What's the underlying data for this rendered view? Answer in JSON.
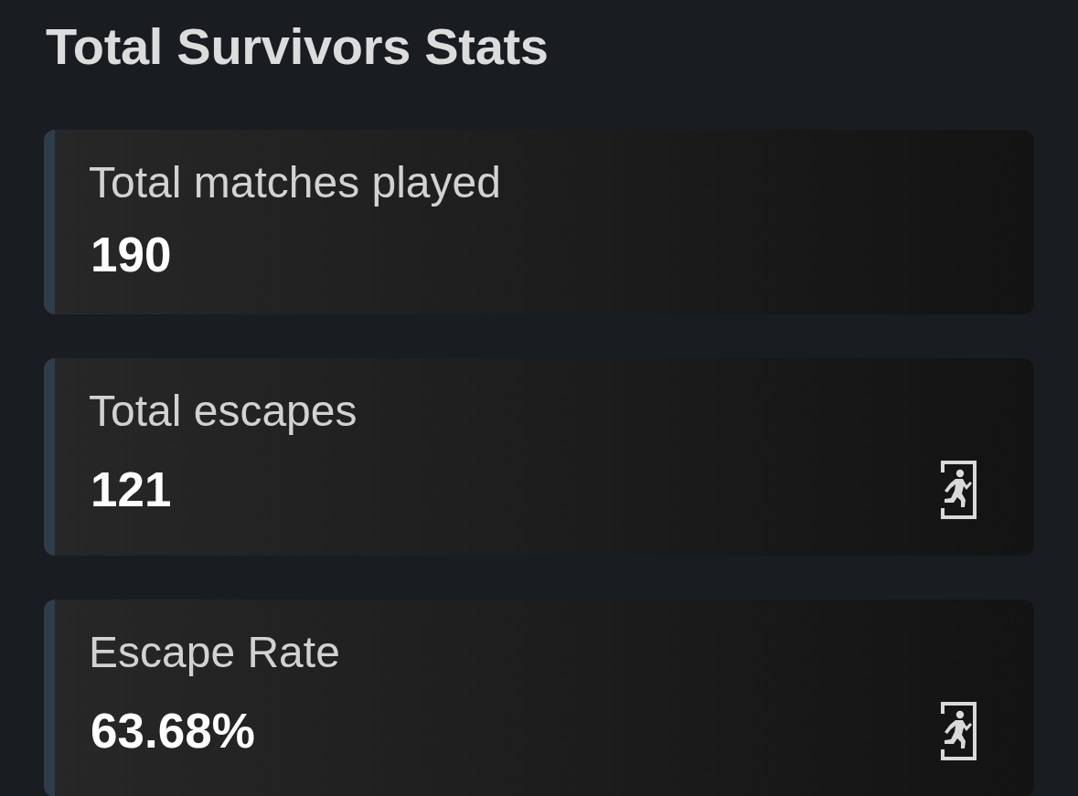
{
  "title": "Total Survivors Stats",
  "stats": [
    {
      "kind": "plain",
      "label": "Total matches played",
      "value": "190"
    },
    {
      "kind": "escape",
      "label": "Total escapes",
      "value": "121"
    },
    {
      "kind": "escape",
      "label": "Escape Rate",
      "value": "63.68%"
    }
  ]
}
